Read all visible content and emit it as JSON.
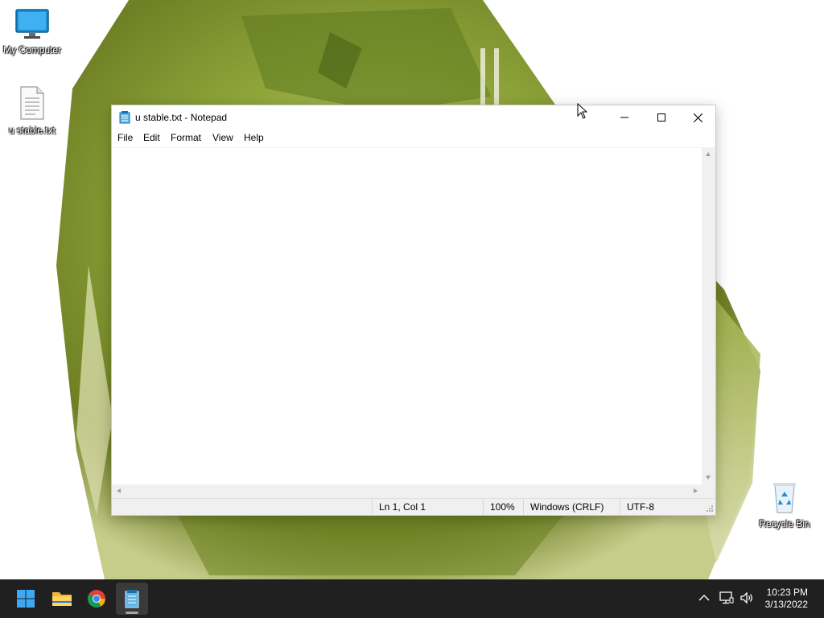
{
  "desktop": {
    "icons": [
      {
        "label": "My Computer",
        "icon": "monitor-icon"
      },
      {
        "label": "u stable.txt",
        "icon": "text-file-icon"
      },
      {
        "label": "Recycle Bin",
        "icon": "recycle-bin-icon"
      }
    ]
  },
  "window": {
    "title": "u stable.txt - Notepad",
    "controls": {
      "minimize": "minimize-icon",
      "maximize": "maximize-icon",
      "close": "close-icon"
    },
    "menu": [
      "File",
      "Edit",
      "Format",
      "View",
      "Help"
    ],
    "content": "",
    "status": {
      "position": "Ln 1, Col 1",
      "zoom": "100%",
      "line_ending": "Windows (CRLF)",
      "encoding": "UTF-8"
    }
  },
  "taskbar": {
    "apps": [
      "start-icon",
      "file-explorer-icon",
      "chrome-icon",
      "notepad-icon"
    ],
    "active_app": "notepad-icon",
    "tray": [
      "chevron-up-icon",
      "network-icon",
      "volume-icon"
    ],
    "time": "10:23 PM",
    "date": "3/13/2022"
  },
  "colors": {
    "taskbar": "#202020",
    "wallpaper_green": "#8aa23a",
    "accent": "#0078d4"
  }
}
